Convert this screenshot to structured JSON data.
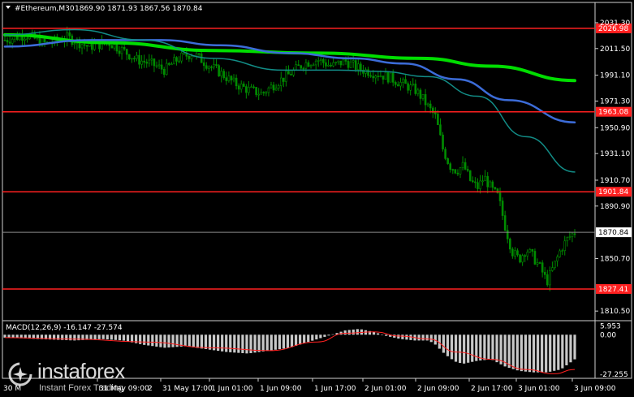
{
  "header": {
    "symbol": "#Ethereum,M30",
    "ohlc": "1869.90 1871.93 1867.56 1870.84"
  },
  "macd_header": "MACD(12,26,9) -16.147 -27.574",
  "brand": {
    "name": "instaforex",
    "tagline": "Instant Forex Trading",
    "logo_icon": "sparkle-ring-icon"
  },
  "chart_data": {
    "type": "candlestick",
    "title": "",
    "xlabel": "",
    "ylabel": "",
    "ylim": [
      1805,
      2035
    ],
    "y_ticks": [
      "2031.30",
      "2011.50",
      "1991.10",
      "1971.30",
      "1950.90",
      "1931.10",
      "1910.70",
      "1890.90",
      "1850.70",
      "1810.50"
    ],
    "x_ticks": [
      "31 May 09:00",
      "31 May 17:00",
      "1 Jun 01:00",
      "1 Jun 09:00",
      "1 Jun 17:00",
      "2 Jun 01:00",
      "2 Jun 09:00",
      "2 Jun 17:00",
      "3 Jun 01:00",
      "3 Jun 09:00"
    ],
    "x_ticks_partial": [
      "30 M",
      "2"
    ],
    "current_price": "1870.84",
    "levels": [
      {
        "label": "2026.98",
        "value": 2026.98,
        "color": "#ff2020"
      },
      {
        "label": "1963.08",
        "value": 1963.08,
        "color": "#ff2020"
      },
      {
        "label": "1901.84",
        "value": 1901.84,
        "color": "#ff2020"
      },
      {
        "label": "1827.41",
        "value": 1827.41,
        "color": "#ff2020"
      }
    ],
    "price_path": [
      [
        0,
        2018
      ],
      [
        6,
        2022
      ],
      [
        12,
        2015
      ],
      [
        18,
        2020
      ],
      [
        24,
        2013
      ],
      [
        30,
        2016
      ],
      [
        34,
        2010
      ],
      [
        38,
        2003
      ],
      [
        42,
        2000
      ],
      [
        46,
        1995
      ],
      [
        50,
        2004
      ],
      [
        54,
        2008
      ],
      [
        58,
        2000
      ],
      [
        62,
        1993
      ],
      [
        66,
        1985
      ],
      [
        70,
        1980
      ],
      [
        74,
        1977
      ],
      [
        78,
        1985
      ],
      [
        82,
        1992
      ],
      [
        86,
        2000
      ],
      [
        90,
        2003
      ],
      [
        94,
        1998
      ],
      [
        98,
        2002
      ],
      [
        102,
        1996
      ],
      [
        106,
        1993
      ],
      [
        110,
        1990
      ],
      [
        114,
        1985
      ],
      [
        118,
        1980
      ],
      [
        120,
        1974
      ],
      [
        122,
        1966
      ],
      [
        124,
        1959
      ],
      [
        126,
        1935
      ],
      [
        128,
        1922
      ],
      [
        130,
        1918
      ],
      [
        132,
        1922
      ],
      [
        134,
        1910
      ],
      [
        136,
        1905
      ],
      [
        138,
        1913
      ],
      [
        140,
        1904
      ],
      [
        142,
        1898
      ],
      [
        144,
        1875
      ],
      [
        146,
        1856
      ],
      [
        148,
        1850
      ],
      [
        150,
        1858
      ],
      [
        152,
        1852
      ],
      [
        154,
        1844
      ],
      [
        156,
        1833
      ],
      [
        158,
        1845
      ],
      [
        160,
        1858
      ],
      [
        162,
        1866
      ],
      [
        164,
        1871
      ]
    ],
    "x_range": [
      0,
      164
    ],
    "series": [
      {
        "name": "",
        "color": "#00dd00",
        "width": 4,
        "points": [
          [
            0,
            2022
          ],
          [
            30,
            2016
          ],
          [
            60,
            2010
          ],
          [
            90,
            2008
          ],
          [
            120,
            2004
          ],
          [
            140,
            1998
          ],
          [
            164,
            1987
          ]
        ]
      },
      {
        "name": "",
        "color": "#3c6cd8",
        "width": 2.5,
        "points": [
          [
            0,
            2013
          ],
          [
            25,
            2018
          ],
          [
            45,
            2018
          ],
          [
            62,
            2014
          ],
          [
            82,
            2008
          ],
          [
            100,
            2004
          ],
          [
            115,
            2000
          ],
          [
            130,
            1988
          ],
          [
            145,
            1972
          ],
          [
            164,
            1955
          ]
        ]
      },
      {
        "name": "",
        "color": "#128c86",
        "width": 1.5,
        "points": [
          [
            0,
            2022
          ],
          [
            20,
            2026
          ],
          [
            40,
            2018
          ],
          [
            60,
            2004
          ],
          [
            80,
            1995
          ],
          [
            96,
            1995
          ],
          [
            108,
            1994
          ],
          [
            122,
            1990
          ],
          [
            136,
            1975
          ],
          [
            150,
            1944
          ],
          [
            164,
            1917
          ]
        ]
      }
    ],
    "macd": {
      "values_label": "5.953",
      "zero_label": "0.00",
      "min_label": "-27.255",
      "ylim": [
        -29,
        8
      ],
      "histogram": [
        [
          0,
          -2
        ],
        [
          10,
          -3
        ],
        [
          20,
          -4
        ],
        [
          28,
          -3
        ],
        [
          34,
          -4
        ],
        [
          40,
          -7
        ],
        [
          46,
          -9
        ],
        [
          52,
          -8
        ],
        [
          58,
          -10
        ],
        [
          64,
          -12
        ],
        [
          70,
          -13
        ],
        [
          76,
          -11
        ],
        [
          82,
          -9
        ],
        [
          86,
          -6
        ],
        [
          90,
          -3
        ],
        [
          94,
          0
        ],
        [
          98,
          3
        ],
        [
          102,
          4
        ],
        [
          106,
          2
        ],
        [
          110,
          -1
        ],
        [
          114,
          -3
        ],
        [
          118,
          -4
        ],
        [
          122,
          -4
        ],
        [
          124,
          -7
        ],
        [
          126,
          -12
        ],
        [
          128,
          -16
        ],
        [
          130,
          -19
        ],
        [
          132,
          -20
        ],
        [
          136,
          -18
        ],
        [
          140,
          -17
        ],
        [
          144,
          -22
        ],
        [
          148,
          -25
        ],
        [
          152,
          -26
        ],
        [
          156,
          -26
        ],
        [
          160,
          -24
        ],
        [
          164,
          -17
        ]
      ],
      "signal": [
        [
          0,
          -2
        ],
        [
          20,
          -3
        ],
        [
          40,
          -5
        ],
        [
          60,
          -9
        ],
        [
          76,
          -11
        ],
        [
          90,
          -5
        ],
        [
          98,
          1
        ],
        [
          106,
          2
        ],
        [
          114,
          -1
        ],
        [
          122,
          -3
        ],
        [
          130,
          -12
        ],
        [
          140,
          -17
        ],
        [
          150,
          -24
        ],
        [
          158,
          -27
        ],
        [
          164,
          -24
        ]
      ]
    }
  }
}
